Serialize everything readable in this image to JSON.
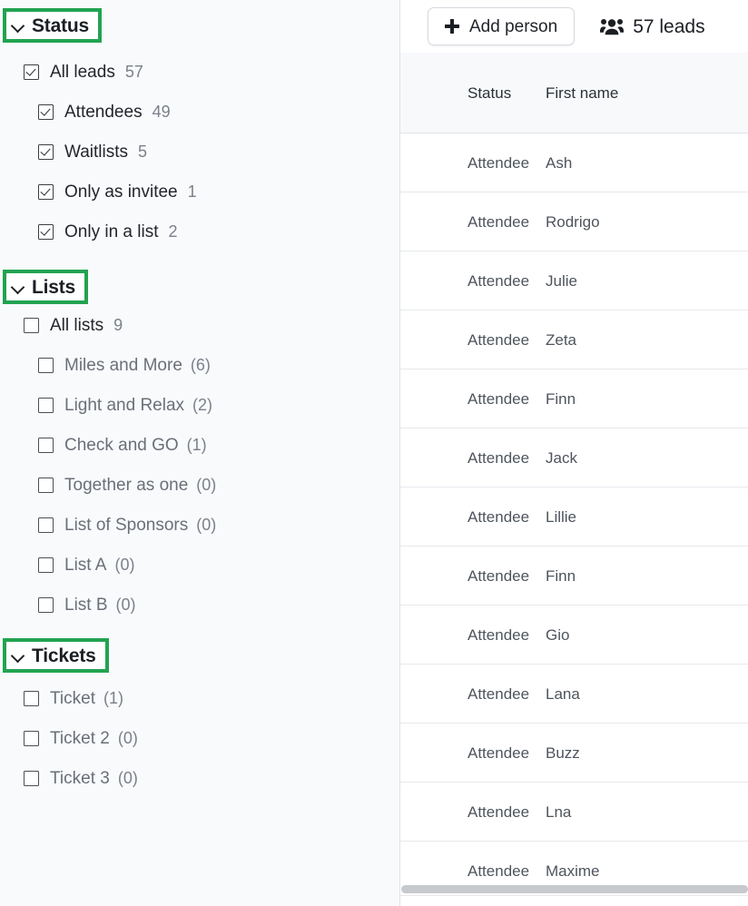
{
  "sidebar": {
    "sections": [
      {
        "id": "status",
        "title": "Status",
        "chevron_icon": "chevron-down-icon",
        "items": [
          {
            "label": "All leads",
            "count": "57",
            "checked": true,
            "indent": 0,
            "muted": false
          },
          {
            "label": "Attendees",
            "count": "49",
            "checked": true,
            "indent": 1,
            "muted": false
          },
          {
            "label": "Waitlists",
            "count": "5",
            "checked": true,
            "indent": 1,
            "muted": false
          },
          {
            "label": "Only as invitee",
            "count": "1",
            "checked": true,
            "indent": 1,
            "muted": false
          },
          {
            "label": "Only in a list",
            "count": "2",
            "checked": true,
            "indent": 1,
            "muted": false
          }
        ]
      },
      {
        "id": "lists",
        "title": "Lists",
        "chevron_icon": "chevron-down-icon",
        "items": [
          {
            "label": "All lists",
            "count": "9",
            "checked": false,
            "indent": 0,
            "muted": false
          },
          {
            "label": "Miles and More",
            "count": "(6)",
            "checked": false,
            "indent": 1,
            "muted": true
          },
          {
            "label": "Light and Relax",
            "count": "(2)",
            "checked": false,
            "indent": 1,
            "muted": true
          },
          {
            "label": "Check and GO",
            "count": "(1)",
            "checked": false,
            "indent": 1,
            "muted": true
          },
          {
            "label": "Together as one",
            "count": "(0)",
            "checked": false,
            "indent": 1,
            "muted": true
          },
          {
            "label": "List of Sponsors",
            "count": "(0)",
            "checked": false,
            "indent": 1,
            "muted": true
          },
          {
            "label": "List A",
            "count": "(0)",
            "checked": false,
            "indent": 1,
            "muted": true
          },
          {
            "label": "List B",
            "count": "(0)",
            "checked": false,
            "indent": 1,
            "muted": true
          }
        ]
      },
      {
        "id": "tickets",
        "title": "Tickets",
        "chevron_icon": "chevron-down-icon",
        "items": [
          {
            "label": "Ticket",
            "count": "(1)",
            "checked": false,
            "indent": 0,
            "muted": true
          },
          {
            "label": "Ticket 2",
            "count": "(0)",
            "checked": false,
            "indent": 0,
            "muted": true
          },
          {
            "label": "Ticket 3",
            "count": "(0)",
            "checked": false,
            "indent": 0,
            "muted": true
          }
        ]
      }
    ],
    "highlight_color": "#22a351"
  },
  "toolbar": {
    "add_person_label": "Add person",
    "add_person_icon": "plus-icon",
    "leads_icon": "users-group-icon",
    "leads_label": "57 leads"
  },
  "table": {
    "columns": [
      "Status",
      "First name"
    ],
    "rows": [
      {
        "status": "Attendee",
        "first_name": "Ash"
      },
      {
        "status": "Attendee",
        "first_name": "Rodrigo"
      },
      {
        "status": "Attendee",
        "first_name": "Julie"
      },
      {
        "status": "Attendee",
        "first_name": "Zeta"
      },
      {
        "status": "Attendee",
        "first_name": "Finn"
      },
      {
        "status": "Attendee",
        "first_name": "Jack"
      },
      {
        "status": "Attendee",
        "first_name": "Lillie"
      },
      {
        "status": "Attendee",
        "first_name": "Finn"
      },
      {
        "status": "Attendee",
        "first_name": "Gio"
      },
      {
        "status": "Attendee",
        "first_name": "Lana"
      },
      {
        "status": "Attendee",
        "first_name": "Buzz"
      },
      {
        "status": "Attendee",
        "first_name": "Lna"
      },
      {
        "status": "Attendee",
        "first_name": "Maxime"
      }
    ]
  }
}
